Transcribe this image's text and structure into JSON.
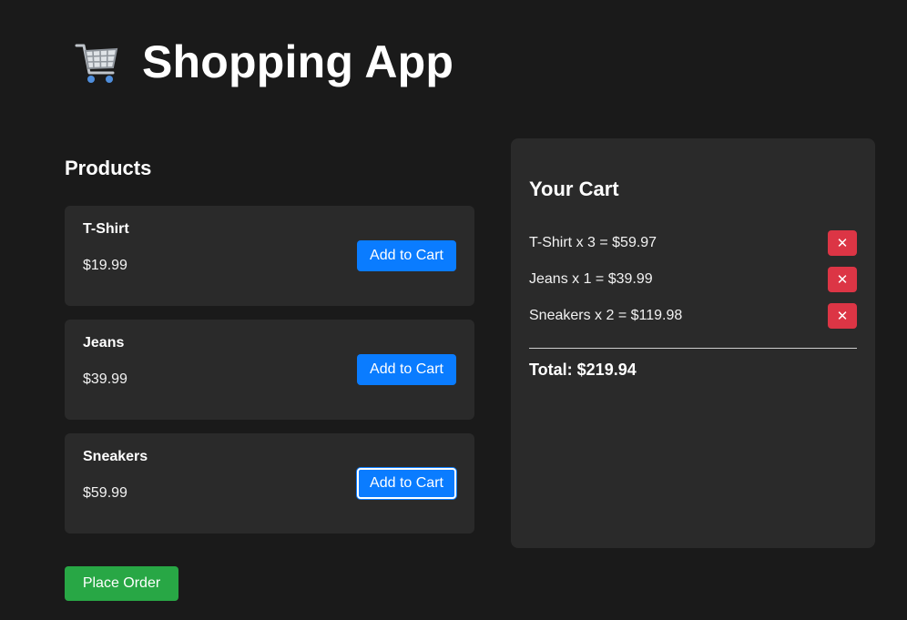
{
  "header": {
    "icon": "shopping-cart-icon",
    "title": "Shopping App"
  },
  "products": {
    "title": "Products",
    "items": [
      {
        "name": "T-Shirt",
        "price": "$19.99",
        "button": "Add to Cart"
      },
      {
        "name": "Jeans",
        "price": "$39.99",
        "button": "Add to Cart"
      },
      {
        "name": "Sneakers",
        "price": "$59.99",
        "button": "Add to Cart"
      }
    ]
  },
  "actions": {
    "place_order": "Place Order"
  },
  "cart": {
    "title": "Your Cart",
    "items": [
      {
        "text": "T-Shirt x 3 = $59.97",
        "remove": "✕"
      },
      {
        "text": "Jeans x 1 = $39.99",
        "remove": "✕"
      },
      {
        "text": "Sneakers x 2 = $119.98",
        "remove": "✕"
      }
    ],
    "total": "Total: $219.94"
  },
  "colors": {
    "background": "#1a1a1a",
    "card": "#2a2a2a",
    "primary": "#0a7cff",
    "success": "#28a745",
    "danger": "#dc3545"
  }
}
